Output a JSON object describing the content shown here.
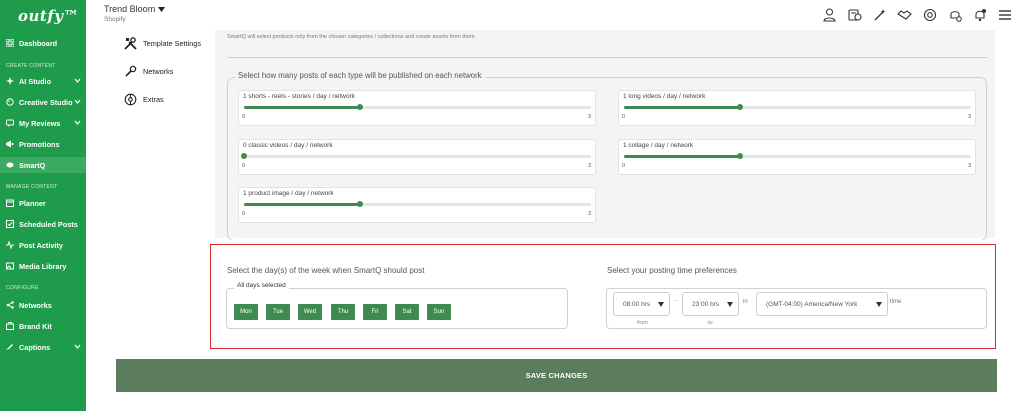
{
  "app": {
    "logo": "outfy™",
    "store_name": "Trend Bloom",
    "store_platform": "Shopify"
  },
  "sidebar": {
    "sections": {
      "create": "CREATE CONTENT",
      "manage": "MANAGE CONTENT",
      "configure": "CONFIGURE"
    },
    "items": [
      {
        "label": "Dashboard",
        "icon": "dashboard-icon"
      },
      {
        "label": "AI Studio",
        "icon": "ai-studio-icon"
      },
      {
        "label": "Creative Studio",
        "icon": "creative-studio-icon"
      },
      {
        "label": "My Reviews",
        "icon": "reviews-icon"
      },
      {
        "label": "Promotions",
        "icon": "promotions-icon"
      },
      {
        "label": "SmartQ",
        "icon": "smartq-icon"
      },
      {
        "label": "Planner",
        "icon": "planner-icon"
      },
      {
        "label": "Scheduled Posts",
        "icon": "scheduled-posts-icon"
      },
      {
        "label": "Post Activity",
        "icon": "post-activity-icon"
      },
      {
        "label": "Media Library",
        "icon": "media-library-icon"
      },
      {
        "label": "Networks",
        "icon": "networks-icon"
      },
      {
        "label": "Brand Kit",
        "icon": "brand-kit-icon"
      },
      {
        "label": "Captions",
        "icon": "captions-icon"
      }
    ]
  },
  "settings_nav": [
    {
      "label": "Template Settings",
      "icon": "tools-icon"
    },
    {
      "label": "Networks",
      "icon": "wrench-icon"
    },
    {
      "label": "Extras",
      "icon": "extras-icon"
    }
  ],
  "content": {
    "top_note": "SmartQ will select products only from the chosen categories / collections and create assets from them",
    "posts_legend": "Select how many posts of each type will be published on each network",
    "sliders": [
      {
        "label": "1 shorts - reels - stories / day / network",
        "min": "0",
        "max": "3",
        "value": 1
      },
      {
        "label": "1 long videos / day / network",
        "min": "0",
        "max": "3",
        "value": 1
      },
      {
        "label": "0 classic videos / day / network",
        "min": "0",
        "max": "3",
        "value": 0
      },
      {
        "label": "1 collage / day / network",
        "min": "0",
        "max": "3",
        "value": 1
      },
      {
        "label": "1 product image / day / network",
        "min": "0",
        "max": "3",
        "value": 1
      }
    ]
  },
  "schedule": {
    "days_title": "Select the day(s) of the week when SmartQ should post",
    "days_legend": "All days selected",
    "days": [
      "Mon",
      "Tue",
      "Wed",
      "Thu",
      "Fri",
      "Sat",
      "Sun"
    ],
    "time_title": "Select your posting time preferences",
    "from_value": "08:00 hrs",
    "from_label": "from",
    "dash": "-",
    "to_value": "23:00 hrs",
    "to_label": "to",
    "in_label": "in",
    "timezone": "(GMT-04:00) America/New York",
    "time_label": "time"
  },
  "save_label": "SAVE CHANGES",
  "colors": {
    "sidebar": "#1e9c4b",
    "accent": "#3f8a50",
    "save_bar": "#5c7d5d",
    "highlight": "#d32f2f"
  }
}
